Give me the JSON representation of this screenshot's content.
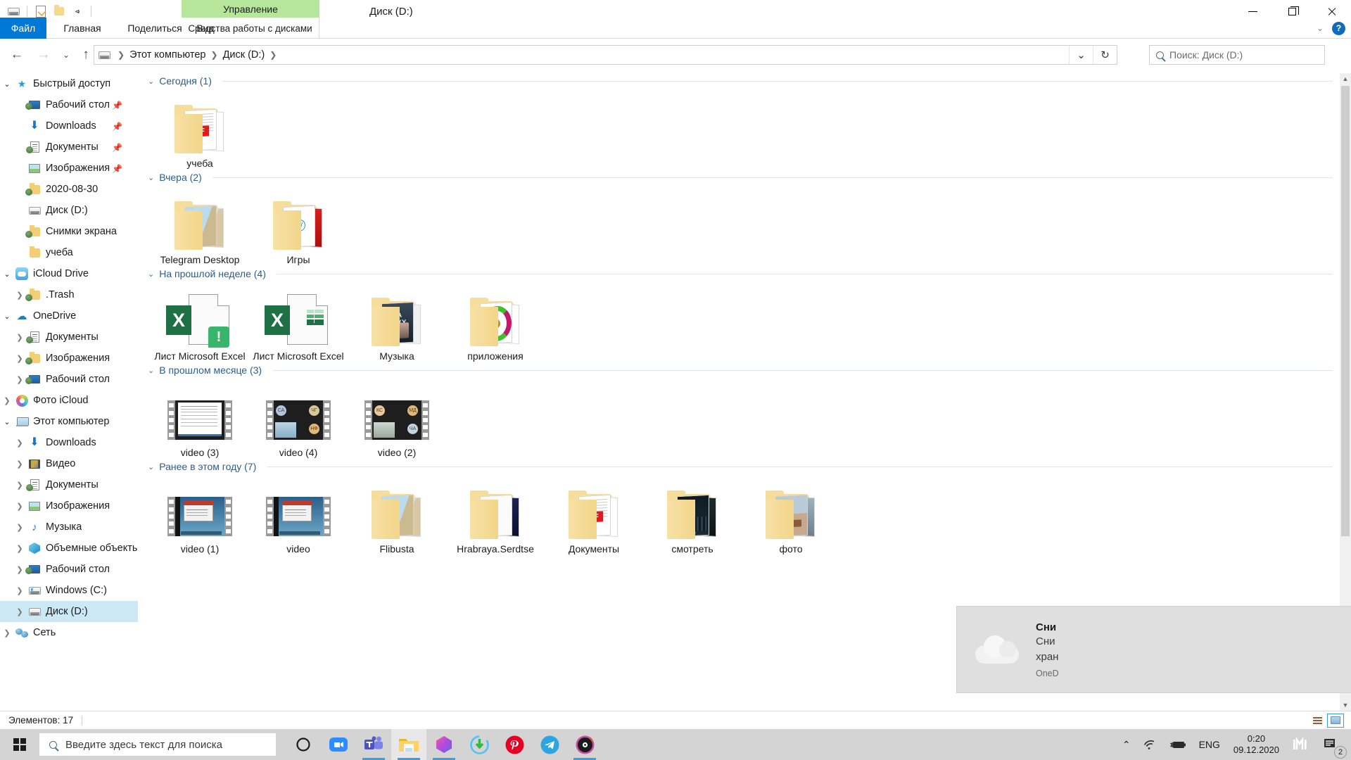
{
  "window": {
    "title": "Диск  (D:)",
    "quick_access_icons": [
      "drive-icon",
      "properties-icon",
      "new-folder-icon",
      "customize-chevron-icon"
    ],
    "contextual_tab": "Управление",
    "contextual_group": "Средства работы с дисками",
    "minimize": "—",
    "maximize": "□",
    "close": "✕"
  },
  "ribbon": {
    "tabs": [
      {
        "label": "Файл",
        "active": true
      },
      {
        "label": "Главная",
        "active": false
      },
      {
        "label": "Поделиться",
        "active": false
      },
      {
        "label": "Вид",
        "active": false
      }
    ],
    "tools_tab": "Средства работы с дисками",
    "collapse_icon": "chevron-down-icon",
    "help_icon": "?"
  },
  "address": {
    "back": "←",
    "forward": "→",
    "recent": "⌄",
    "up": "↑",
    "crumbs": [
      "Этот компьютер",
      "Диск  (D:)"
    ],
    "dropdown": "⌄",
    "refresh": "↻"
  },
  "search": {
    "placeholder": "Поиск: Диск  (D:)",
    "icon": "search-icon"
  },
  "sidebar": {
    "items": [
      {
        "label": "Быстрый доступ",
        "icon": "star-icon",
        "indent": 0,
        "chevron": "open",
        "pinned": false
      },
      {
        "label": "Рабочий стол",
        "icon": "desktop-shared-icon",
        "indent": 1,
        "chevron": "none",
        "pinned": true
      },
      {
        "label": "Downloads",
        "icon": "downloads-icon",
        "indent": 1,
        "chevron": "none",
        "pinned": true
      },
      {
        "label": "Документы",
        "icon": "documents-shared-icon",
        "indent": 1,
        "chevron": "none",
        "pinned": true
      },
      {
        "label": "Изображения",
        "icon": "pictures-icon",
        "indent": 1,
        "chevron": "none",
        "pinned": true
      },
      {
        "label": "2020-08-30",
        "icon": "folder-shared-icon",
        "indent": 1,
        "chevron": "none",
        "pinned": false
      },
      {
        "label": "Диск  (D:)",
        "icon": "drive-icon",
        "indent": 1,
        "chevron": "none",
        "pinned": false
      },
      {
        "label": "Снимки экрана",
        "icon": "folder-shared-icon",
        "indent": 1,
        "chevron": "none",
        "pinned": false
      },
      {
        "label": "учеба",
        "icon": "folder-icon",
        "indent": 1,
        "chevron": "none",
        "pinned": false
      },
      {
        "label": "iCloud Drive",
        "icon": "icloud-icon",
        "indent": 0,
        "chevron": "open",
        "pinned": false
      },
      {
        "label": ".Trash",
        "icon": "folder-shared-icon",
        "indent": 1,
        "chevron": "closed",
        "pinned": false
      },
      {
        "label": "OneDrive",
        "icon": "onedrive-icon",
        "indent": 0,
        "chevron": "open",
        "pinned": false
      },
      {
        "label": "Документы",
        "icon": "documents-shared-icon",
        "indent": 1,
        "chevron": "closed",
        "pinned": false
      },
      {
        "label": "Изображения",
        "icon": "folder-shared-icon",
        "indent": 1,
        "chevron": "closed",
        "pinned": false
      },
      {
        "label": "Рабочий стол",
        "icon": "desktop-shared-icon",
        "indent": 1,
        "chevron": "closed",
        "pinned": false
      },
      {
        "label": "Фото iCloud",
        "icon": "photos-icon",
        "indent": 0,
        "chevron": "closed",
        "pinned": false
      },
      {
        "label": "Этот компьютер",
        "icon": "this-pc-icon",
        "indent": 0,
        "chevron": "open",
        "pinned": false
      },
      {
        "label": "Downloads",
        "icon": "downloads-icon",
        "indent": 1,
        "chevron": "closed",
        "pinned": false
      },
      {
        "label": "Видео",
        "icon": "videos-icon",
        "indent": 1,
        "chevron": "closed",
        "pinned": false
      },
      {
        "label": "Документы",
        "icon": "documents-shared-icon",
        "indent": 1,
        "chevron": "closed",
        "pinned": false
      },
      {
        "label": "Изображения",
        "icon": "pictures-icon",
        "indent": 1,
        "chevron": "closed",
        "pinned": false
      },
      {
        "label": "Музыка",
        "icon": "music-icon",
        "indent": 1,
        "chevron": "closed",
        "pinned": false
      },
      {
        "label": "Объемные объекты",
        "icon": "3d-objects-icon",
        "indent": 1,
        "chevron": "closed",
        "pinned": false
      },
      {
        "label": "Рабочий стол",
        "icon": "desktop-shared-icon",
        "indent": 1,
        "chevron": "closed",
        "pinned": false
      },
      {
        "label": "Windows (C:)",
        "icon": "windows-drive-icon",
        "indent": 1,
        "chevron": "closed",
        "pinned": false
      },
      {
        "label": "Диск  (D:)",
        "icon": "drive-icon",
        "indent": 1,
        "chevron": "closed",
        "pinned": false,
        "selected": true
      },
      {
        "label": "Сеть",
        "icon": "network-icon",
        "indent": 0,
        "chevron": "closed",
        "pinned": false
      }
    ]
  },
  "content": {
    "groups": [
      {
        "title": "Сегодня (1)",
        "items": [
          {
            "name": "учеба",
            "kind": "folder-pdf"
          }
        ]
      },
      {
        "title": "Вчера (2)",
        "items": [
          {
            "name": "Telegram Desktop",
            "kind": "folder-notes"
          },
          {
            "name": "Игры",
            "kind": "folder-games"
          }
        ]
      },
      {
        "title": "На прошлой неделе (4)",
        "items": [
          {
            "name": "Лист Microsoft Excel",
            "kind": "excel-warning"
          },
          {
            "name": "Лист Microsoft Excel",
            "kind": "excel"
          },
          {
            "name": "Музыка",
            "kind": "folder-music"
          },
          {
            "name": "приложения",
            "kind": "folder-apps"
          }
        ]
      },
      {
        "title": "В прошлом месяце (3)",
        "items": [
          {
            "name": "video (3)",
            "kind": "video-slide"
          },
          {
            "name": "video (4)",
            "kind": "video-meeting-a"
          },
          {
            "name": "video (2)",
            "kind": "video-meeting-b"
          }
        ]
      },
      {
        "title": "Ранее в этом году (7)",
        "items": [
          {
            "name": "video (1)",
            "kind": "video-desktop"
          },
          {
            "name": "video",
            "kind": "video-desktop"
          },
          {
            "name": "Flibusta",
            "kind": "folder-notes"
          },
          {
            "name": "Hrabraya.Serdtse",
            "kind": "folder-dark"
          },
          {
            "name": "Документы",
            "kind": "folder-pdf"
          },
          {
            "name": "смотреть",
            "kind": "folder-city"
          },
          {
            "name": "фото",
            "kind": "folder-photo"
          }
        ]
      }
    ]
  },
  "status": {
    "count_label": "Элементов: 17",
    "view_details_icon": "details-view-icon",
    "view_tiles_icon": "tiles-view-icon"
  },
  "toast": {
    "icon": "onedrive-cloud-icon",
    "title": "Сни",
    "line1": "Сни",
    "line2": "хран",
    "app": "OneD"
  },
  "taskbar": {
    "start_icon": "windows-start-icon",
    "search_placeholder": "Введите здесь текст для поиска",
    "search_icon": "search-icon",
    "apps": [
      {
        "name": "cortana-icon",
        "running": false,
        "active": false
      },
      {
        "name": "zoom-icon",
        "running": false,
        "active": false
      },
      {
        "name": "microsoft-teams-icon",
        "running": true,
        "active": false
      },
      {
        "name": "file-explorer-icon",
        "running": true,
        "active": true
      },
      {
        "name": "photos-gem-icon",
        "running": true,
        "active": false
      },
      {
        "name": "download-manager-icon",
        "running": false,
        "active": false
      },
      {
        "name": "pinterest-icon",
        "running": false,
        "active": false
      },
      {
        "name": "telegram-icon",
        "running": false,
        "active": false
      },
      {
        "name": "media-player-icon",
        "running": true,
        "active": false
      }
    ],
    "tray": {
      "overflow_icon": "chevron-up-icon",
      "wifi_icon": "wifi-icon",
      "battery_icon": "battery-charging-icon",
      "language": "ENG",
      "time": "0:20",
      "date": "09.12.2020",
      "extra_icon": "imi-icon",
      "notifications_icon": "action-center-icon",
      "notifications_count": "2"
    }
  }
}
